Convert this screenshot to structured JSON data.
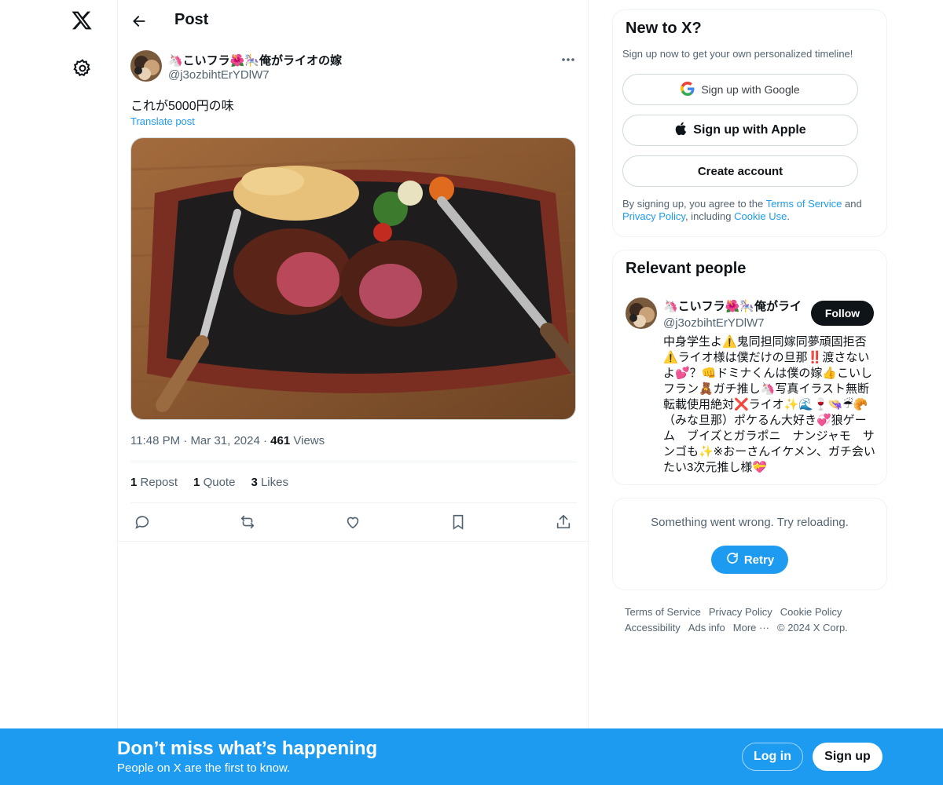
{
  "nav": {
    "logo_icon": "x-logo-icon",
    "settings_icon": "gear-icon"
  },
  "header": {
    "title": "Post",
    "back_icon": "arrow-left-icon"
  },
  "post": {
    "author_name": "🦄こいフラ🌺🎠俺がライオの嫁",
    "author_handle": "@j3ozbihtErYDlW7",
    "text": "これが5000円の味",
    "translate_label": "Translate post",
    "media_description": "steak-on-iron-plate-photo",
    "time": "11:48 PM",
    "date": "Mar 31, 2024",
    "views_count": "461",
    "views_label": "Views",
    "reposts_count": "1",
    "reposts_label": "Repost",
    "quotes_count": "1",
    "quotes_label": "Quote",
    "likes_count": "3",
    "likes_label": "Likes"
  },
  "signup_card": {
    "title": "New to X?",
    "subtitle": "Sign up now to get your own personalized timeline!",
    "google_label": "Sign up with Google",
    "apple_label": "Sign up with Apple",
    "create_label": "Create account",
    "legal_prefix": "By signing up, you agree to the ",
    "terms_link": "Terms of Service",
    "legal_and": " and ",
    "privacy_link": "Privacy Policy",
    "legal_including": ", including ",
    "cookie_link": "Cookie Use",
    "legal_suffix": "."
  },
  "relevant": {
    "title": "Relevant people",
    "name": "🦄こいフラ🌺🎠俺がライ",
    "handle": "@j3ozbihtErYDlW7",
    "follow_label": "Follow",
    "bio": "中身学生よ⚠️鬼同担同嫁同夢頑固拒否⚠️ライオ様は僕だけの旦那‼️渡さないよ💕？👊ドミナくんは僕の嫁👍こいしフラン🧸ガチ推し🦄写真イラスト無断転載使用絶対❌ライオ✨🌊🍷👒☔🥐（みな旦那）ポケるん大好き💞狼ゲーム　ブイズとガラポニ　ナンジャモ　サンゴも✨※おーさんイケメン、ガチ会いたい3次元推し様💝"
  },
  "error_card": {
    "text": "Something went wrong. Try reloading.",
    "retry_label": "Retry"
  },
  "footer": {
    "terms": "Terms of Service",
    "privacy": "Privacy Policy",
    "cookie": "Cookie Policy",
    "accessibility": "Accessibility",
    "ads": "Ads info",
    "more": "More ···",
    "copyright": "© 2024 X Corp."
  },
  "banner": {
    "title": "Don’t miss what’s happening",
    "subtitle": "People on X are the first to know.",
    "login_label": "Log in",
    "signup_label": "Sign up"
  },
  "colors": {
    "accent": "#1d9bf0",
    "text": "#0f1419",
    "muted": "#536471",
    "border": "#eff3f4"
  }
}
